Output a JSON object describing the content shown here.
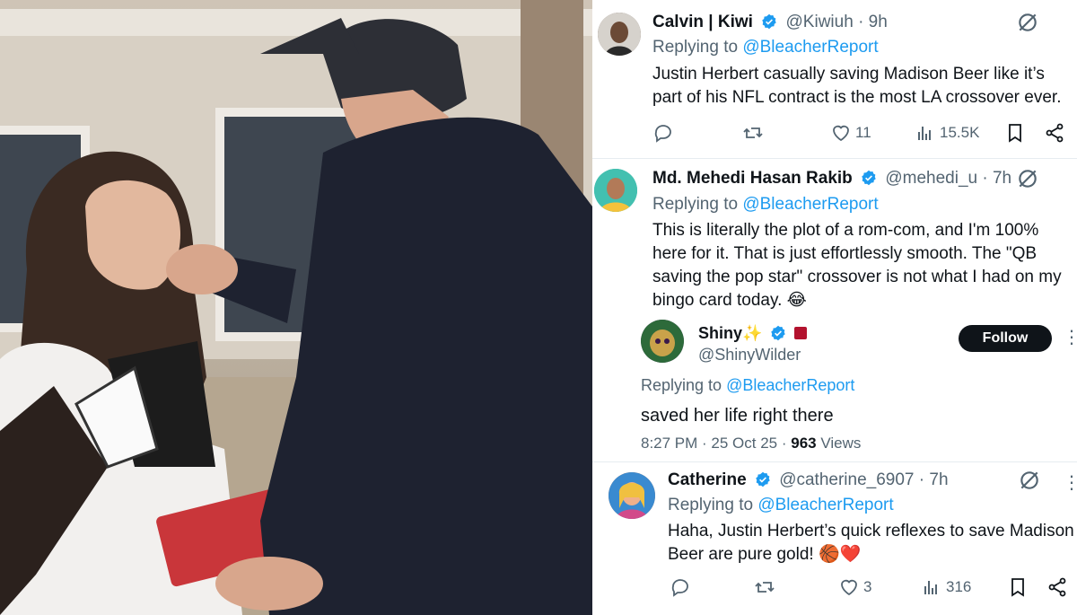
{
  "replies": [
    {
      "name": "Calvin | Kiwi",
      "handle": "@Kiwiuh",
      "time": "· 9h",
      "replying_prefix": "Replying to",
      "replying_to": "@BleacherReport",
      "text": "Justin Herbert casually saving Madison Beer like it’s part of his NFL contract is the most LA crossover ever.",
      "likes": "11",
      "views": "15.5K"
    },
    {
      "name": "Md. Mehedi Hasan Rakib",
      "handle": "@mehedi_u",
      "time": "· 7h",
      "replying_prefix": "Replying to",
      "replying_to": "@BleacherReport",
      "text": "This is literally the plot of a rom-com, and I'm 100% here for it. That is just effortlessly smooth. The \"QB saving the pop star\" crossover is not what I had on my bingo card today. 😂"
    },
    {
      "name": "Catherine",
      "handle": "@catherine_6907",
      "time": "· 7h",
      "replying_prefix": "Replying to",
      "replying_to": "@BleacherReport",
      "text": "Haha, Justin Herbert’s quick reflexes to save Madison Beer are pure gold! 🏀❤️",
      "likes": "3",
      "views": "316"
    }
  ],
  "embedded": {
    "name": "Shiny✨",
    "handle": "@ShinyWilder",
    "follow_label": "Follow",
    "replying_prefix": "Replying to",
    "replying_to": "@BleacherReport",
    "text": "saved her life right there",
    "meta": "8:27 PM · 25 Oct 25 · ",
    "views_count": "963",
    "views_label": " Views"
  },
  "colors": {
    "accent": "#1d9bf0",
    "muted": "#536471",
    "text": "#0f1419",
    "verified": "#1d9bf0"
  },
  "icons": [
    "grok-icon",
    "reply-icon",
    "retweet-icon",
    "like-icon",
    "views-icon",
    "bookmark-icon",
    "share-icon",
    "verified-icon",
    "more-icon"
  ]
}
